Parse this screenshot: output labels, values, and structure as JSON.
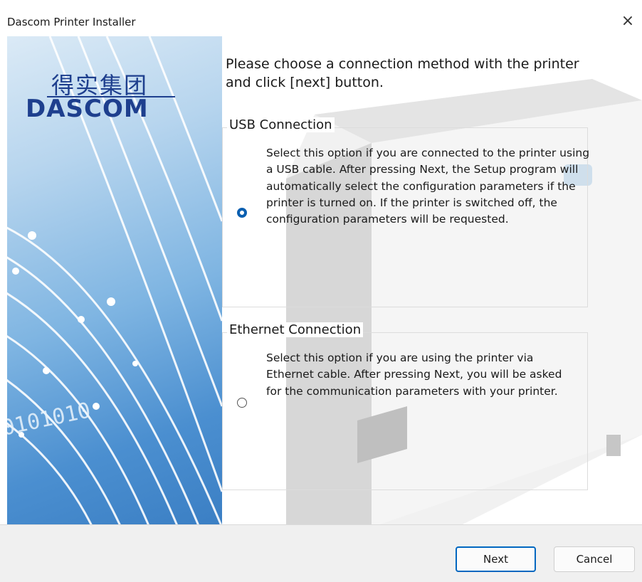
{
  "window": {
    "title": "Dascom Printer Installer",
    "close_label": "×"
  },
  "banner": {
    "logo_cn": "得实集团",
    "logo_en": "DASCOM",
    "digits": "0101010"
  },
  "main": {
    "instruction": "Please choose a connection method with the printer and click [next] button.",
    "options": [
      {
        "label": "USB Connection",
        "description": "Select this option if you are connected to the printer using a USB cable. After pressing Next, the Setup program will automatically select the configuration parameters if the printer is turned on. If the printer is switched off, the configuration parameters will be requested.",
        "selected": true
      },
      {
        "label": "Ethernet Connection",
        "description": "Select this option if you are using the printer via Ethernet cable. After pressing Next, you will be asked for the communication parameters with your printer.",
        "selected": false
      }
    ]
  },
  "footer": {
    "next_label": "Next",
    "cancel_label": "Cancel"
  },
  "colors": {
    "accent": "#0067c0",
    "logo": "#1e3f8e"
  }
}
